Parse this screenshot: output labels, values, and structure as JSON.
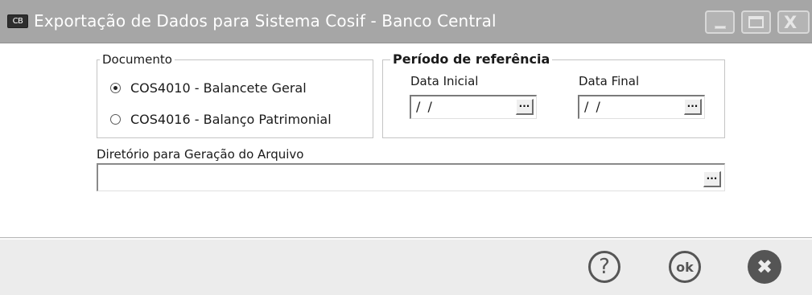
{
  "window": {
    "app_icon_text": "CB",
    "title": "Exportação de Dados para Sistema Cosif - Banco Central",
    "buttons": {
      "minimize_icon": "minimize-icon",
      "maximize_icon": "maximize-icon",
      "close_icon": "close-icon",
      "close_glyph": "X"
    }
  },
  "documento": {
    "legend": "Documento",
    "options": [
      {
        "label": "COS4010 - Balancete Geral",
        "selected": true
      },
      {
        "label": "COS4016 - Balanço Patrimonial",
        "selected": false
      }
    ]
  },
  "periodo": {
    "legend": "Período de referência",
    "data_inicial": {
      "label": "Data Inicial",
      "value": "/ /",
      "button": "..."
    },
    "data_final": {
      "label": "Data Final",
      "value": "/ /",
      "button": "..."
    }
  },
  "diretorio": {
    "label": "Diretório para Geração do Arquivo",
    "value": "",
    "button": "..."
  },
  "footer": {
    "help_glyph": "?",
    "ok_glyph": "ok",
    "cancel_glyph": "✖"
  }
}
